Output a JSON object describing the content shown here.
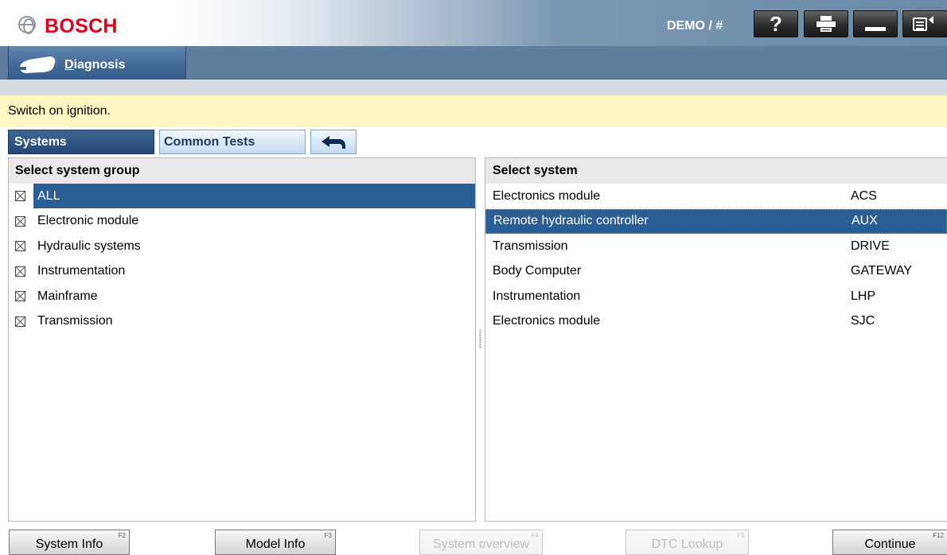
{
  "header": {
    "brand": "BOSCH",
    "session": "DEMO / #",
    "help_label": "?"
  },
  "nav": {
    "diagnosis_prefix": "D",
    "diagnosis_rest": "iagnosis"
  },
  "message": "Switch on ignition.",
  "tabs": {
    "systems": "Systems",
    "common_tests": "Common Tests"
  },
  "left_panel": {
    "title": "Select system group",
    "items": [
      {
        "label": "ALL",
        "selected": true
      },
      {
        "label": "Electronic module",
        "selected": false
      },
      {
        "label": "Hydraulic systems",
        "selected": false
      },
      {
        "label": "Instrumentation",
        "selected": false
      },
      {
        "label": "Mainframe",
        "selected": false
      },
      {
        "label": "Transmission",
        "selected": false
      }
    ]
  },
  "right_panel": {
    "title": "Select system",
    "items": [
      {
        "name": "Electronics module",
        "code": "ACS",
        "selected": false
      },
      {
        "name": "Remote hydraulic controller",
        "code": "AUX",
        "selected": true
      },
      {
        "name": "Transmission",
        "code": "DRIVE",
        "selected": false
      },
      {
        "name": "Body Computer",
        "code": "GATEWAY",
        "selected": false
      },
      {
        "name": "Instrumentation",
        "code": "LHP",
        "selected": false
      },
      {
        "name": "Electronics module",
        "code": "SJC",
        "selected": false
      }
    ]
  },
  "footer": {
    "buttons": [
      {
        "label": "System Info",
        "key": "F2",
        "enabled": true
      },
      {
        "label": "Model Info",
        "key": "F3",
        "enabled": true
      },
      {
        "label": "System overview",
        "key": "F4",
        "enabled": false
      },
      {
        "label": "DTC Lookup",
        "key": "F5",
        "enabled": false
      },
      {
        "label": "Continue",
        "key": "F12",
        "enabled": true
      }
    ]
  },
  "colors": {
    "brand_red": "#e0001a",
    "selection_blue": "#2b5e93",
    "message_bg": "#fdf6c3",
    "navbar": "#5d7e9f"
  },
  "icons": [
    "bosch-logo-icon",
    "help-icon",
    "print-icon",
    "minimize-icon",
    "window-switch-icon",
    "car-diagnosis-icon",
    "back-arrow-icon",
    "checkbox-cross-icon"
  ]
}
